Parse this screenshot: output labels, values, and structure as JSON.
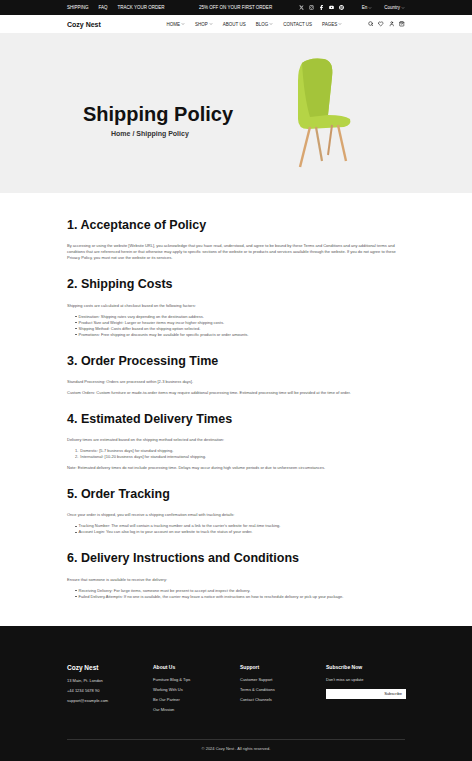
{
  "topbar": {
    "links": [
      "SHIPPING",
      "FAQ",
      "TRACK YOUR ORDER"
    ],
    "promo": "25% OFF ON YOUR FIRST ORDER",
    "language": "En",
    "country": "Country"
  },
  "nav": {
    "logo": "Cozy Nest",
    "menu": [
      {
        "label": "HOME",
        "dropdown": true
      },
      {
        "label": "SHOP",
        "dropdown": true
      },
      {
        "label": "ABOUT US",
        "dropdown": false
      },
      {
        "label": "BLOG",
        "dropdown": true
      },
      {
        "label": "CONTACT US",
        "dropdown": false
      },
      {
        "label": "PAGES",
        "dropdown": true
      }
    ]
  },
  "hero": {
    "title": "Shipping Policy",
    "breadcrumb": "Home / Shipping Policy"
  },
  "sections": [
    {
      "heading": "1. Acceptance of Policy",
      "blocks": [
        {
          "kind": "paragraph",
          "text": "By accessing or using the website [Website URL], you acknowledge that you have read, understood, and agree to be bound by these Terms and Conditions and any additional terms and conditions that are referenced herein or that otherwise may apply to specific sections of the website or to products and services available through the website. If you do not agree to these Privacy Policy, you must not use the website or its services."
        }
      ]
    },
    {
      "heading": "2. Shipping Costs",
      "blocks": [
        {
          "kind": "paragraph",
          "text": "Shipping costs are calculated at checkout based on the following factors:"
        },
        {
          "kind": "bullets",
          "items": [
            "Destination: Shipping rates vary depending on the destination address.",
            "Product Size and Weight: Larger or heavier items may incur higher shipping costs.",
            "Shipping Method: Costs differ based on the shipping option selected.",
            "Promotions: Free shipping or discounts may be available for specific products or order amounts."
          ]
        }
      ]
    },
    {
      "heading": "3. Order Processing Time",
      "blocks": [
        {
          "kind": "paragraph",
          "text": "Standard Processing: Orders are processed within [2-3 business days]."
        },
        {
          "kind": "paragraph",
          "text": "Custom Orders: Custom furniture or made-to-order items may require additional processing time. Estimated processing time will be provided at the time of order."
        }
      ]
    },
    {
      "heading": "4. Estimated Delivery Times",
      "blocks": [
        {
          "kind": "paragraph",
          "text": "Delivery times are estimated based on the shipping method selected and the destination:"
        },
        {
          "kind": "numbered",
          "items": [
            {
              "number": "1.",
              "text": "Domestic: [5-7 business days] for standard shipping."
            },
            {
              "number": "2.",
              "text": "International: [10-20 business days] for standard international shipping."
            }
          ]
        },
        {
          "kind": "paragraph",
          "text": "Note: Estimated delivery times do not include processing time. Delays may occur during high volume periods or due to unforeseen circumstances."
        }
      ]
    },
    {
      "heading": "5. Order Tracking",
      "blocks": [
        {
          "kind": "paragraph",
          "text": "Once your order is shipped, you will receive a shipping confirmation email with tracking details:"
        },
        {
          "kind": "bullets",
          "items": [
            "Tracking Number: The email will contain a tracking number and a link to the carrier's website for real-time tracking.",
            "Account Login: You can also log in to your account on our website to track the status of your order."
          ]
        }
      ]
    },
    {
      "heading": "6. Delivery Instructions and Conditions",
      "blocks": [
        {
          "kind": "paragraph",
          "text": "Ensure that someone is available to receive the delivery:"
        },
        {
          "kind": "bullets",
          "items": [
            "Receiving Delivery: For large items, someone must be present to accept and inspect the delivery.",
            "Failed Delivery Attempts: If no one is available, the carrier may leave a notice with instructions on how to reschedule delivery or pick up your package."
          ]
        }
      ]
    }
  ],
  "footer": {
    "brand": {
      "name": "Cozy Nest",
      "lines": [
        "13 Main, Pt. London",
        "+44 1234 5678 90",
        "support@example.com"
      ]
    },
    "columns": [
      {
        "title": "About Us",
        "links": [
          "Furniture Blog & Tips",
          "Working With Us",
          "Be Our Partner",
          "Our Mission"
        ]
      },
      {
        "title": "Support",
        "links": [
          "Customer Support",
          "Terms & Conditions",
          "Contact Channels"
        ]
      }
    ],
    "subscribe": {
      "title": "Subscribe Now",
      "text": "Don't miss an update",
      "button": "Subscribe"
    },
    "copyright": "© 2024 Cozy Nest . All rights reserved."
  }
}
